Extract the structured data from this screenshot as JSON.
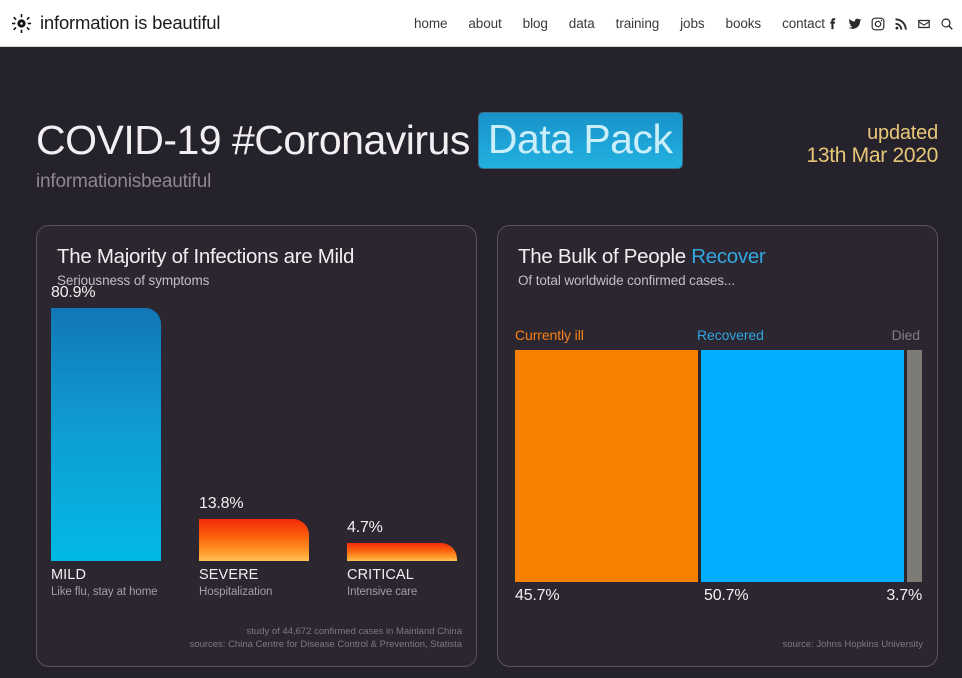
{
  "site": {
    "brand_name": "information is beautiful",
    "logo_icon": "sun-burst-icon",
    "nav": [
      {
        "label": "home"
      },
      {
        "label": "about"
      },
      {
        "label": "blog"
      },
      {
        "label": "data"
      },
      {
        "label": "training"
      },
      {
        "label": "jobs"
      },
      {
        "label": "books"
      },
      {
        "label": "contact"
      }
    ],
    "social": [
      {
        "icon": "facebook-icon"
      },
      {
        "icon": "twitter-icon"
      },
      {
        "icon": "instagram-icon"
      },
      {
        "icon": "rss-icon"
      },
      {
        "icon": "email-icon"
      },
      {
        "icon": "search-icon"
      }
    ]
  },
  "hero": {
    "title_main": "COVID-19 #Coronavirus",
    "title_highlight": "Data Pack",
    "sub_brand": "informationisbeautiful",
    "updated_label": "updated",
    "updated_date": "13th Mar 2020",
    "highlight_color": "#22b1e0",
    "updated_color": "#e8c878"
  },
  "cards": {
    "left": {
      "title": "The Majority of Infections are Mild",
      "subtitle": "Seriousness of symptoms",
      "source_line_1": "study of 44,672 confirmed cases in Mainland China",
      "source_line_2": "sources: China Centre for Disease Control & Prevention, Statista"
    },
    "right": {
      "title_plain": "The Bulk of People ",
      "title_accent": "Recover",
      "subtitle": "Of total worldwide confirmed cases...",
      "source": "source: Johns Hopkins University"
    }
  },
  "chart_data": [
    {
      "type": "bar",
      "title": "The Majority of Infections are Mild",
      "subtitle": "Seriousness of symptoms",
      "xlabel": "",
      "ylabel": "",
      "ylim": [
        0,
        100
      ],
      "grid": false,
      "legend": "none",
      "categories": [
        "MILD",
        "SEVERE",
        "CRITICAL"
      ],
      "values": [
        80.9,
        13.8,
        4.7
      ],
      "value_labels": [
        "80.9%",
        "13.8%",
        "4.7%"
      ],
      "category_descriptions": [
        "Like flu, stay at home",
        "Hospitalization",
        "Intensive care"
      ],
      "colors": [
        "#0f9bd0",
        "#f95f0b",
        "#f95f0b"
      ],
      "annotation": "study of 44,672 confirmed cases in Mainland China"
    },
    {
      "type": "bar",
      "subtype": "stacked-100",
      "title": "The Bulk of People Recover",
      "subtitle": "Of total worldwide confirmed cases...",
      "xlabel": "",
      "ylabel": "",
      "grid": false,
      "legend": "top",
      "categories": [
        "Currently ill",
        "Recovered",
        "Died"
      ],
      "values": [
        45.7,
        50.7,
        3.7
      ],
      "value_labels": [
        "45.7%",
        "50.7%",
        "3.7%"
      ],
      "colors": [
        "#f98000",
        "#00aeff",
        "#7d7b75"
      ],
      "annotation": "source: Johns Hopkins University"
    }
  ]
}
